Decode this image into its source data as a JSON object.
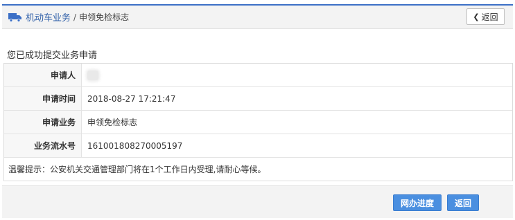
{
  "breadcrumb": {
    "section": "机动车业务",
    "separator": "/",
    "current": "申领免检标志"
  },
  "header": {
    "back_label": "返回"
  },
  "success_message": "您已成功提交业务申请",
  "details": [
    {
      "label": "申请人",
      "value": ""
    },
    {
      "label": "申请时间",
      "value": "2018-08-27 17:21:47"
    },
    {
      "label": "申请业务",
      "value": "申领免检标志"
    },
    {
      "label": "业务流水号",
      "value": "161001808270005197"
    }
  ],
  "tip": "温馨提示：公安机关交通管理部门将在1个工作日内受理,请耐心等候。",
  "footer": {
    "progress_label": "网办进度",
    "back_label": "返回"
  },
  "colors": {
    "accent": "#3b6fc6",
    "button": "#4a8fe0",
    "link": "#2f5fa8"
  },
  "icons": {
    "breadcrumb": "truck-icon",
    "back": "chevron-left-icon"
  }
}
